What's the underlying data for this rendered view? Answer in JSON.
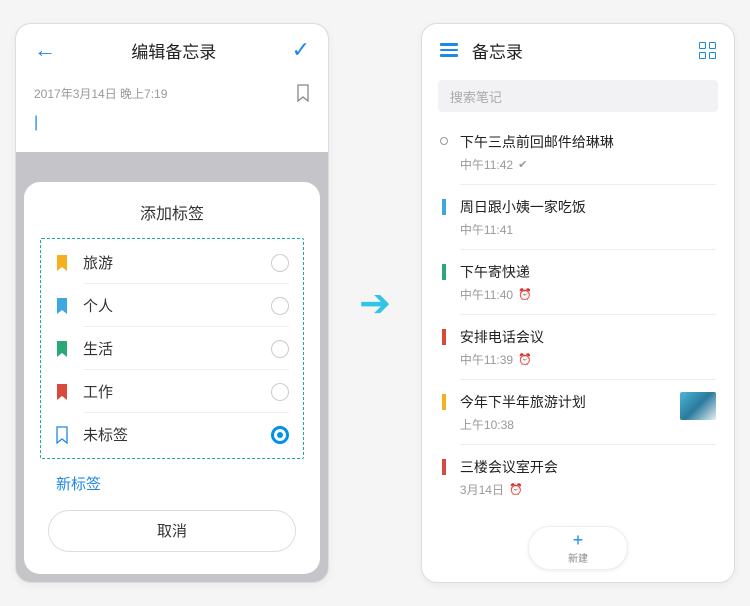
{
  "left": {
    "header_title": "编辑备忘录",
    "timestamp": "2017年3月14日 晚上7:19",
    "sheet_title": "添加标签",
    "tags": [
      {
        "label": "旅游",
        "color": "#f5b020",
        "selected": false
      },
      {
        "label": "个人",
        "color": "#3fa7e0",
        "selected": false
      },
      {
        "label": "生活",
        "color": "#2aa876",
        "selected": false
      },
      {
        "label": "工作",
        "color": "#d94a3e",
        "selected": false
      },
      {
        "label": "未标签",
        "color": "outline",
        "selected": true
      }
    ],
    "new_tag": "新标签",
    "cancel": "取消"
  },
  "right": {
    "header_title": "备忘录",
    "search_placeholder": "搜索笔记",
    "memos": [
      {
        "title": "下午三点前回邮件给琳琳",
        "time": "中午11:42",
        "marker": "outline",
        "icon": "check"
      },
      {
        "title": "周日跟小姨一家吃饭",
        "time": "中午11:41",
        "marker": "#3fa7e0",
        "icon": ""
      },
      {
        "title": "下午寄快递",
        "time": "中午11:40",
        "marker": "#2aa876",
        "icon": "clock"
      },
      {
        "title": "安排电话会议",
        "time": "中午11:39",
        "marker": "#d94a3e",
        "icon": "clock"
      },
      {
        "title": "今年下半年旅游计划",
        "time": "上午10:38",
        "marker": "#f5b020",
        "icon": "",
        "thumb": true
      },
      {
        "title": "三楼会议室开会",
        "time": "3月14日",
        "marker": "#d94a3e",
        "icon": "clock"
      }
    ],
    "fab_label": "新建"
  }
}
